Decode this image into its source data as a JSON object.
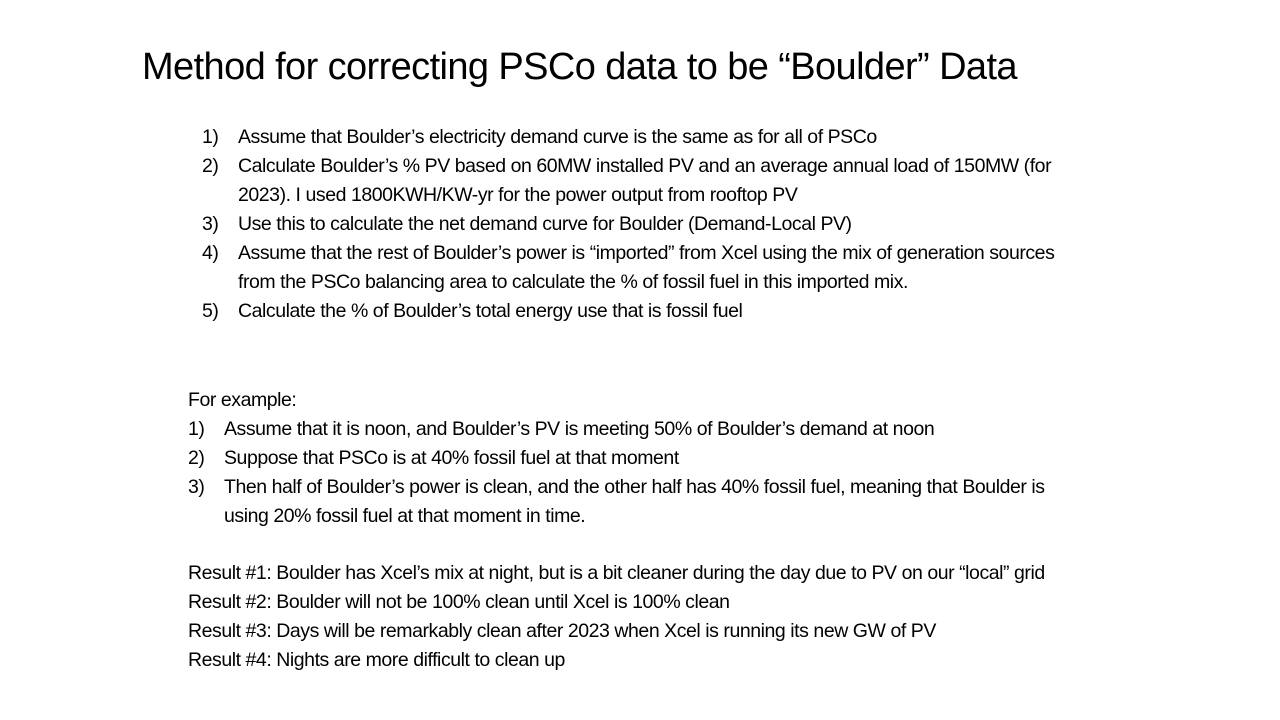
{
  "slide": {
    "title": "Method for correcting PSCo data to be “Boulder” Data",
    "method_steps": [
      {
        "number": "1)",
        "text": "Assume that Boulder’s electricity demand curve is the same as for all of PSCo"
      },
      {
        "number": "2)",
        "text": "Calculate Boulder’s % PV based on 60MW installed PV and an average annual load of 150MW (for 2023).  I used 1800KWH/KW-yr for the power output from rooftop PV"
      },
      {
        "number": "3)",
        "text": "Use this to calculate the net demand curve for Boulder (Demand-Local PV)"
      },
      {
        "number": "4)",
        "text": "Assume that the rest of Boulder’s power is “imported” from Xcel using the mix of generation sources from the PSCo balancing area to calculate the % of fossil fuel in this imported mix."
      },
      {
        "number": "5)",
        "text": "Calculate the % of Boulder’s total energy use that is fossil fuel"
      }
    ],
    "example": {
      "heading": "For example:",
      "steps": [
        {
          "number": "1)",
          "text": "Assume that it is noon, and Boulder’s PV is meeting 50% of Boulder’s demand at noon"
        },
        {
          "number": "2)",
          "text": "Suppose that PSCo is at 40% fossil fuel at that moment"
        },
        {
          "number": "3)",
          "text": "Then half of Boulder’s power is clean, and the other half has 40% fossil fuel, meaning that Boulder is using 20% fossil fuel at that moment in time."
        }
      ]
    },
    "results": [
      "Result #1:  Boulder has Xcel’s mix at night, but is a bit cleaner during the day due to PV on our “local” grid",
      "Result #2:  Boulder will not be 100% clean until Xcel is 100% clean",
      "Result #3:  Days will be remarkably clean after 2023 when Xcel is running its new GW of PV",
      "Result #4:  Nights are more difficult to clean up"
    ]
  }
}
